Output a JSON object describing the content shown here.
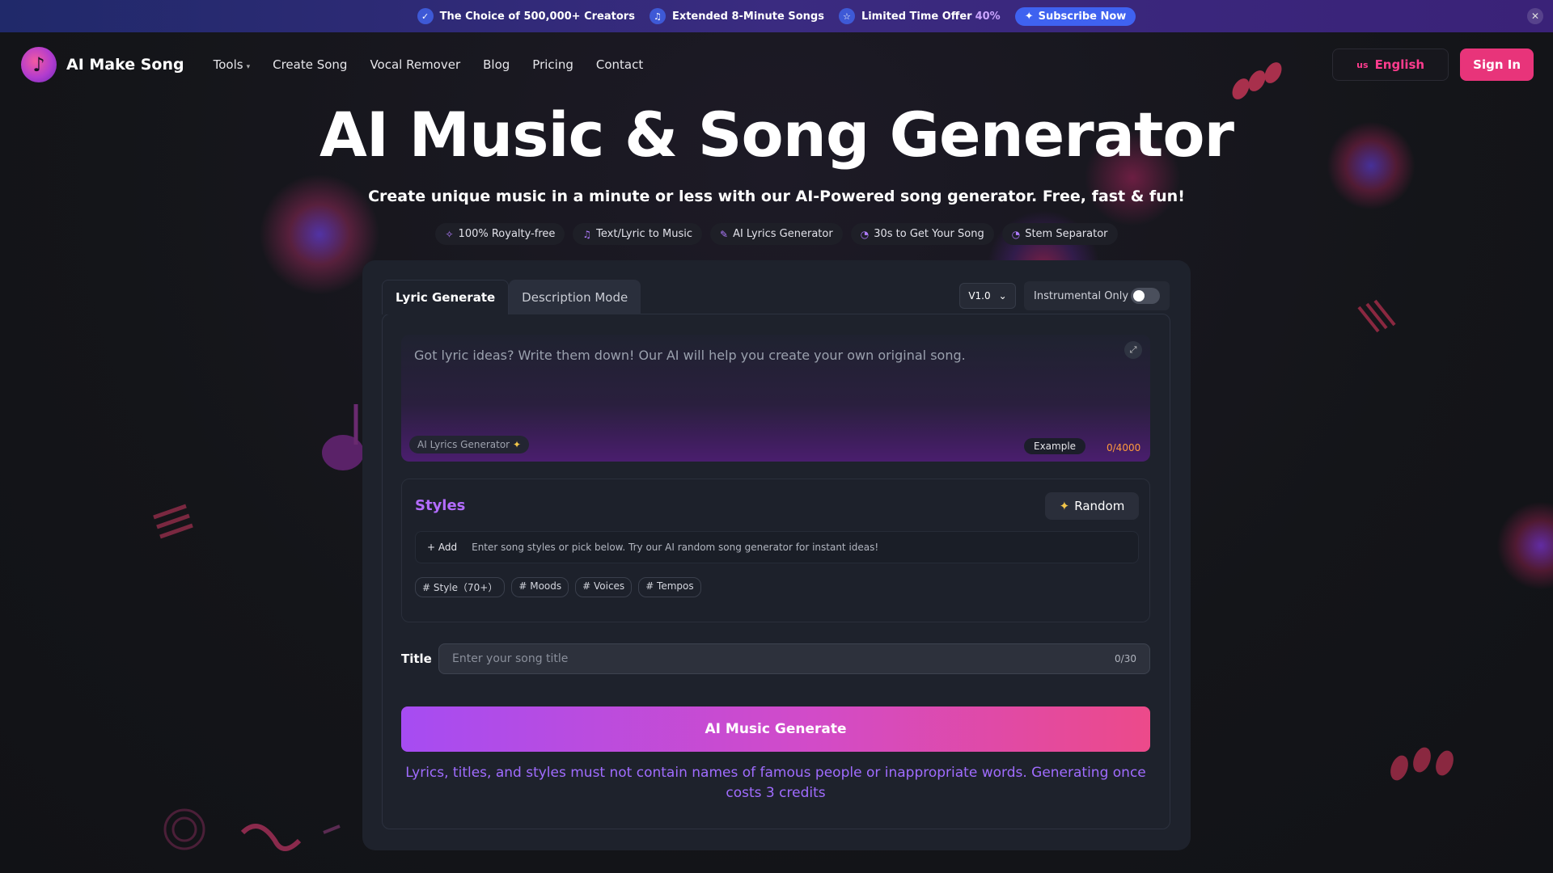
{
  "banner": {
    "items": [
      {
        "icon": "check-icon",
        "text": "The Choice of 500,000+ Creators"
      },
      {
        "icon": "music-note-icon",
        "text": "Extended 8-Minute Songs"
      },
      {
        "icon": "star-icon",
        "text": "Limited Time Offer"
      }
    ],
    "offer_pct": "40%",
    "subscribe_label": "Subscribe Now"
  },
  "nav": {
    "brand": "AI Make Song",
    "menu": [
      "Tools",
      "Create Song",
      "Vocal Remover",
      "Blog",
      "Pricing",
      "Contact"
    ],
    "lang_flag": "us",
    "lang_label": "English",
    "signin_label": "Sign In"
  },
  "hero": {
    "title": "AI Music & Song Generator",
    "subtitle": "Create unique music in a minute or less with our AI-Powered song generator. Free, fast & fun!",
    "chips": [
      {
        "icon": "sparkle-icon",
        "label": "100% Royalty-free"
      },
      {
        "icon": "music-note-icon",
        "label": "Text/Lyric to Music"
      },
      {
        "icon": "pen-icon",
        "label": "AI Lyrics Generator"
      },
      {
        "icon": "timer-icon",
        "label": "30s to Get Your Song"
      },
      {
        "icon": "timer-icon",
        "label": "Stem Separator"
      }
    ]
  },
  "generator": {
    "tabs": [
      "Lyric Generate",
      "Description Mode"
    ],
    "active_tab": "Lyric Generate",
    "version": "V1.0",
    "instrumental_label": "Instrumental Only",
    "instrumental_on": false,
    "lyrics": {
      "placeholder": "Got lyric ideas? Write them down! Our AI will help you create your own original song.",
      "ai_lyrics_button": "AI Lyrics Generator",
      "example_label": "Example",
      "counter": "0/4000"
    },
    "styles": {
      "title": "Styles",
      "random_label": "Random",
      "add_label": "+ Add",
      "add_placeholder": "Enter song styles or pick below. Try our AI random song generator for instant ideas!",
      "tags": [
        "# Style（70+）",
        "# Moods",
        "# Voices",
        "# Tempos"
      ]
    },
    "title_field": {
      "label": "Title",
      "placeholder": "Enter your song title",
      "counter": "0/30"
    },
    "generate_label": "AI Music Generate",
    "note": "Lyrics, titles, and styles must not contain names of famous people or inappropriate words. Generating once costs 3 credits"
  },
  "colors": {
    "accent_pink": "#e8347a",
    "accent_purple": "#a64cf2",
    "styles_title": "#b36cff",
    "counter_orange": "#ff9a3c"
  }
}
